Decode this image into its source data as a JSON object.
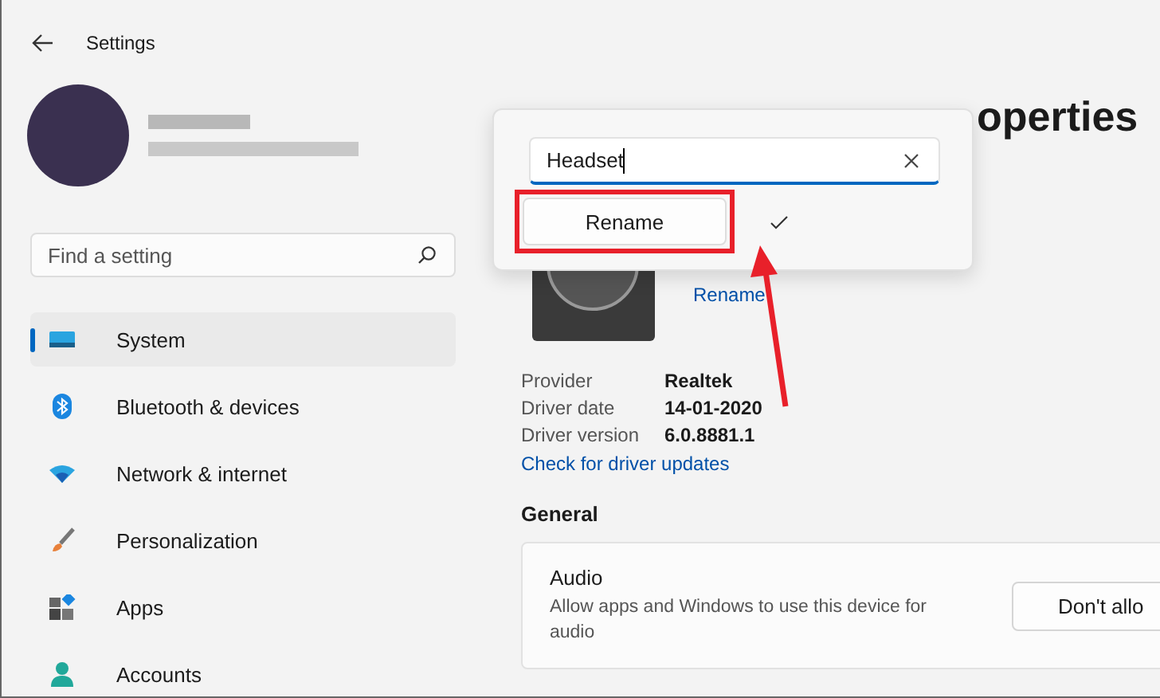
{
  "window": {
    "title": "Settings"
  },
  "search": {
    "placeholder": "Find a setting"
  },
  "nav": [
    {
      "label": "System",
      "kind": "system",
      "selected": true
    },
    {
      "label": "Bluetooth & devices",
      "kind": "bluetooth",
      "selected": false
    },
    {
      "label": "Network & internet",
      "kind": "network",
      "selected": false
    },
    {
      "label": "Personalization",
      "kind": "personalization",
      "selected": false
    },
    {
      "label": "Apps",
      "kind": "apps",
      "selected": false
    },
    {
      "label": "Accounts",
      "kind": "accounts",
      "selected": false
    }
  ],
  "page": {
    "title": "operties",
    "rename_link": "Rename",
    "details": [
      {
        "label": "Provider",
        "value": "Realtek"
      },
      {
        "label": "Driver date",
        "value": "14-01-2020"
      },
      {
        "label": "Driver version",
        "value": "6.0.8881.1"
      }
    ],
    "driver_link": "Check for driver updates",
    "section": "General",
    "setting": {
      "title": "Audio",
      "description": "Allow apps and Windows to use this device for audio",
      "button": "Don't allo"
    }
  },
  "rename_popup": {
    "value": "Headset",
    "button": "Rename",
    "highlighted": true
  }
}
